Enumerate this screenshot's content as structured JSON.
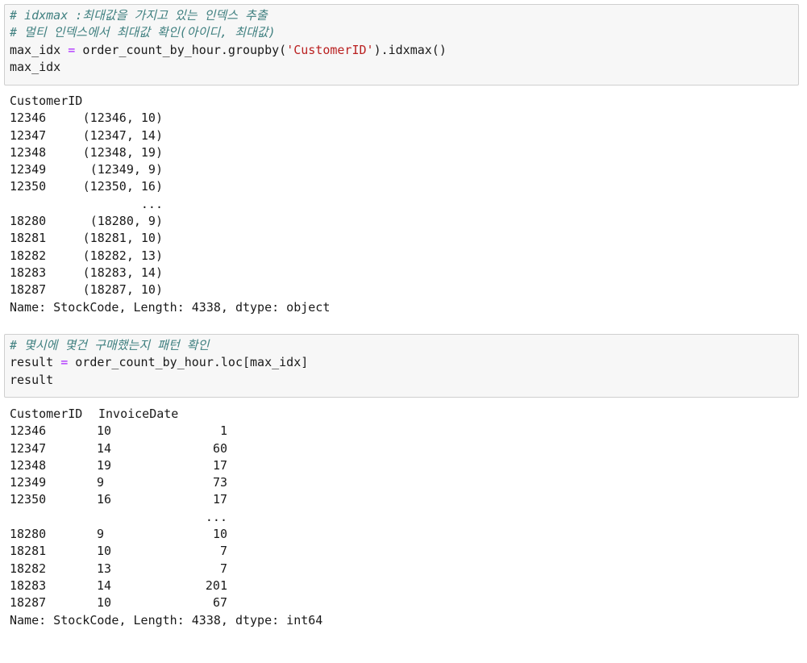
{
  "cell1": {
    "comment1": "# idxmax :최대값을 가지고 있는 인덱스 추출",
    "comment2": "# 멀티 인덱스에서 최대값 확인(아이디, 최대값)",
    "code_var": "max_idx",
    "code_op": "=",
    "code_call_pre": "order_count_by_hour.groupby(",
    "code_str": "'CustomerID'",
    "code_call_post": ").idxmax()",
    "code_line2": "max_idx"
  },
  "output1": {
    "header": "CustomerID",
    "rows": [
      {
        "id": "12346",
        "value": "(12346, 10)"
      },
      {
        "id": "12347",
        "value": "(12347, 14)"
      },
      {
        "id": "12348",
        "value": "(12348, 19)"
      },
      {
        "id": "12349",
        "value": "(12349, 9)"
      },
      {
        "id": "12350",
        "value": "(12350, 16)"
      },
      {
        "id": "",
        "value": "..."
      },
      {
        "id": "18280",
        "value": "(18280, 9)"
      },
      {
        "id": "18281",
        "value": "(18281, 10)"
      },
      {
        "id": "18282",
        "value": "(18282, 13)"
      },
      {
        "id": "18283",
        "value": "(18283, 14)"
      },
      {
        "id": "18287",
        "value": "(18287, 10)"
      }
    ],
    "footer": "Name: StockCode, Length: 4338, dtype: object"
  },
  "cell2": {
    "comment": "# 몇시에 몇건 구매했는지 패턴 확인",
    "code_var": "result",
    "code_op": "=",
    "code_call": "order_count_by_hour.loc[max_idx]",
    "code_line2": "result"
  },
  "output2": {
    "header_col1": "CustomerID",
    "header_col2": "InvoiceDate",
    "rows": [
      {
        "id": "12346",
        "hour": "10",
        "count": "1"
      },
      {
        "id": "12347",
        "hour": "14",
        "count": "60"
      },
      {
        "id": "12348",
        "hour": "19",
        "count": "17"
      },
      {
        "id": "12349",
        "hour": "9",
        "count": "73"
      },
      {
        "id": "12350",
        "hour": "16",
        "count": "17"
      },
      {
        "id": "",
        "hour": "",
        "count": "..."
      },
      {
        "id": "18280",
        "hour": "9",
        "count": "10"
      },
      {
        "id": "18281",
        "hour": "10",
        "count": "7"
      },
      {
        "id": "18282",
        "hour": "13",
        "count": "7"
      },
      {
        "id": "18283",
        "hour": "14",
        "count": "201"
      },
      {
        "id": "18287",
        "hour": "10",
        "count": "67"
      }
    ],
    "footer": "Name: StockCode, Length: 4338, dtype: int64"
  }
}
